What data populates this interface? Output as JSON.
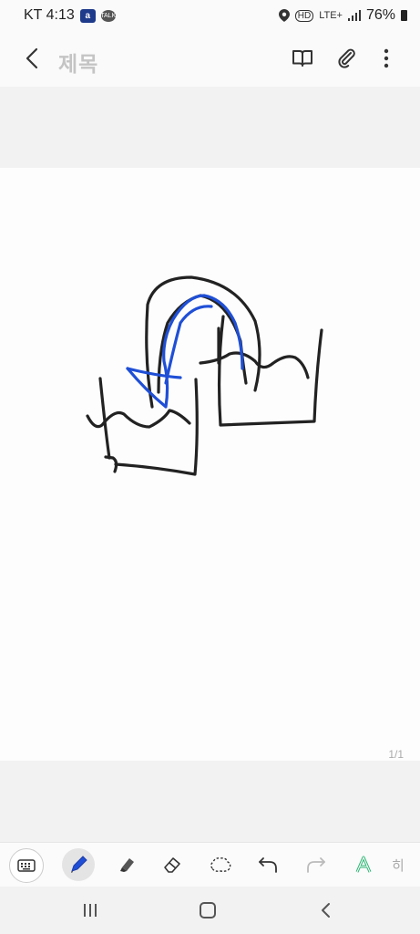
{
  "status_bar": {
    "carrier_time": "KT 4:13",
    "app_badge_1": "a",
    "app_badge_2": "TALK",
    "hd_label": "HD",
    "network_label": "LTE+",
    "battery_percent": "76%",
    "icons": [
      "square-app-icon",
      "kakaotalk-icon",
      "location-icon",
      "hd-icon",
      "lte-icon",
      "signal-icon",
      "battery-icon"
    ]
  },
  "app_bar": {
    "title": "제목",
    "icons": [
      "back-arrow-icon",
      "book-icon",
      "paperclip-icon",
      "more-vertical-icon"
    ]
  },
  "canvas": {
    "page_indicator": "1/1",
    "stroke_colors": {
      "black": "#222222",
      "blue": "#1f4fd6"
    }
  },
  "toolbar": {
    "tools": [
      "keyboard-icon",
      "pen-icon",
      "highlighter-icon",
      "eraser-icon",
      "lasso-icon",
      "undo-icon",
      "redo-icon",
      "text-style-icon"
    ],
    "active_tool": "pen",
    "partial_label": "히"
  },
  "navigation": {
    "buttons": [
      "recent-apps-icon",
      "home-icon",
      "back-icon"
    ]
  }
}
